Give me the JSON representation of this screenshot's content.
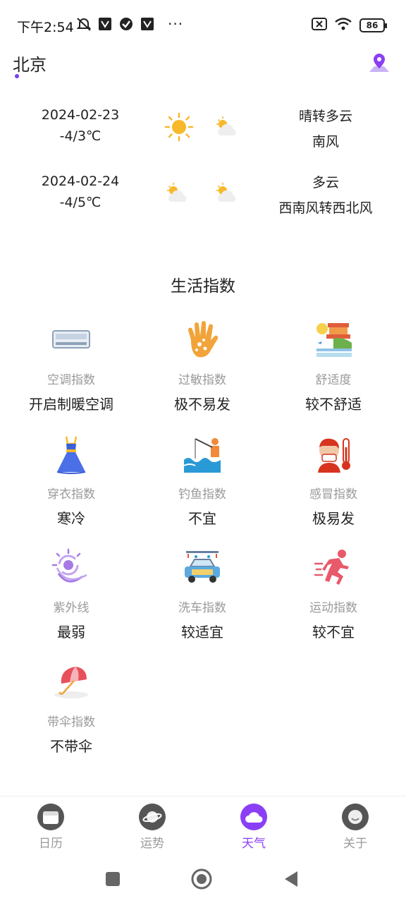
{
  "status_bar": {
    "time": "下午2:54",
    "battery": "86",
    "more": "···"
  },
  "header": {
    "city": "北京"
  },
  "forecast": [
    {
      "date": "2024-02-23",
      "temp": "-4/3℃",
      "condition": "晴转多云",
      "wind": "南风",
      "icon_day": "sun-icon",
      "icon_night": "partly-cloudy-icon"
    },
    {
      "date": "2024-02-24",
      "temp": "-4/5℃",
      "condition": "多云",
      "wind": "西南风转西北风",
      "icon_day": "partly-cloudy-icon",
      "icon_night": "partly-cloudy-icon"
    }
  ],
  "life_index": {
    "title": "生活指数",
    "items": [
      {
        "label": "空调指数",
        "value": "开启制暖空调",
        "icon": "air-conditioner-icon"
      },
      {
        "label": "过敏指数",
        "value": "极不易发",
        "icon": "allergy-hand-icon"
      },
      {
        "label": "舒适度",
        "value": "较不舒适",
        "icon": "comfort-scenery-icon"
      },
      {
        "label": "穿衣指数",
        "value": "寒冷",
        "icon": "dress-icon"
      },
      {
        "label": "钓鱼指数",
        "value": "不宜",
        "icon": "fishing-icon"
      },
      {
        "label": "感冒指数",
        "value": "极易发",
        "icon": "cold-thermometer-icon"
      },
      {
        "label": "紫外线",
        "value": "最弱",
        "icon": "uv-icon"
      },
      {
        "label": "洗车指数",
        "value": "较适宜",
        "icon": "car-wash-icon"
      },
      {
        "label": "运动指数",
        "value": "较不宜",
        "icon": "running-icon"
      },
      {
        "label": "带伞指数",
        "value": "不带伞",
        "icon": "umbrella-icon"
      }
    ]
  },
  "bottom_nav": [
    {
      "label": "日历",
      "icon": "calendar-icon",
      "active": false
    },
    {
      "label": "运势",
      "icon": "planet-icon",
      "active": false
    },
    {
      "label": "天气",
      "icon": "cloud-icon",
      "active": true
    },
    {
      "label": "关于",
      "icon": "about-icon",
      "active": false
    }
  ],
  "colors": {
    "accent": "#8a3ff5",
    "label_gray": "#9a9a9a"
  }
}
